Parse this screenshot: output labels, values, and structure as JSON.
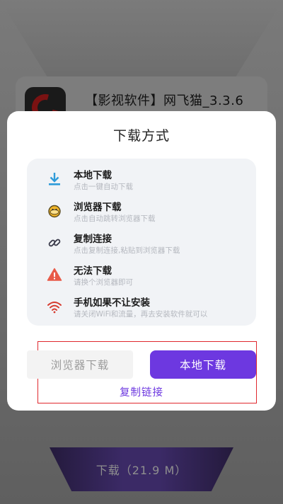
{
  "background": {
    "app_title": "【影视软件】网飞猫_3.3.6",
    "download_button": "下载（21.9 M）"
  },
  "dialog": {
    "title": "下载方式",
    "items": [
      {
        "icon": "download-icon",
        "title": "本地下载",
        "desc": "点击一键自动下载"
      },
      {
        "icon": "browser-icon",
        "title": "浏览器下载",
        "desc": "点击自动跳转浏览器下载"
      },
      {
        "icon": "link-icon",
        "title": "复制连接",
        "desc": "点击复制连接,粘贴到浏览器下载"
      },
      {
        "icon": "warning-icon",
        "title": "无法下载",
        "desc": "请换个浏览器即可"
      },
      {
        "icon": "wifi-icon",
        "title": "手机如果不让安装",
        "desc": "请关闭WiFi和流量，再去安装软件就可以"
      }
    ],
    "browser_download_label": "浏览器下载",
    "local_download_label": "本地下载",
    "copy_link_label": "复制链接"
  },
  "colors": {
    "accent": "#6d38e0",
    "highlight_frame": "#e0282e",
    "download_icon": "#2f9bd9",
    "warning_icon": "#e85a48",
    "wifi_icon": "#d63b2f",
    "browser_icon": "#f0b429"
  }
}
